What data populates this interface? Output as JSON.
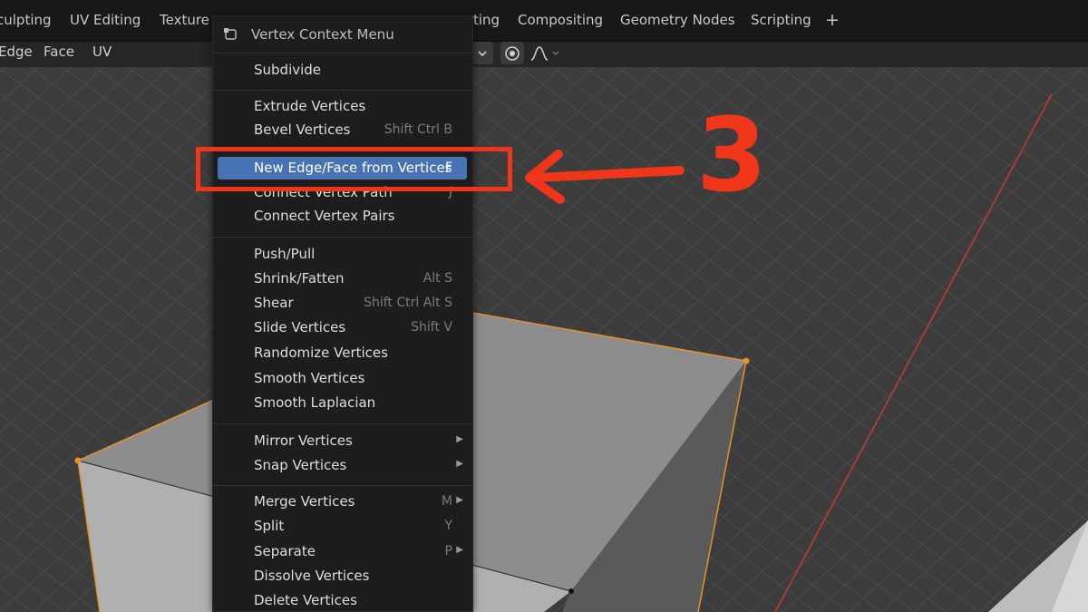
{
  "topbar": {
    "tabs": [
      "culpting",
      "UV Editing",
      "Texture",
      "ting",
      "Compositing",
      "Geometry Nodes",
      "Scripting"
    ],
    "add_tab": "+"
  },
  "header": {
    "mode_items": [
      "Edge",
      "Face",
      "UV"
    ]
  },
  "menu": {
    "title": "Vertex Context Menu",
    "items": [
      {
        "label": "Subdivide",
        "shortcut": ""
      },
      {
        "label": "Extrude Vertices",
        "shortcut": ""
      },
      {
        "label": "Bevel Vertices",
        "shortcut": "Shift Ctrl B"
      },
      {
        "label": "New Edge/Face from Vertices",
        "shortcut": "F"
      },
      {
        "label": "Connect Vertex Path",
        "shortcut": "J"
      },
      {
        "label": "Connect Vertex Pairs",
        "shortcut": ""
      },
      {
        "label": "Push/Pull",
        "shortcut": ""
      },
      {
        "label": "Shrink/Fatten",
        "shortcut": "Alt S"
      },
      {
        "label": "Shear",
        "shortcut": "Shift Ctrl Alt S"
      },
      {
        "label": "Slide Vertices",
        "shortcut": "Shift V"
      },
      {
        "label": "Randomize Vertices",
        "shortcut": ""
      },
      {
        "label": "Smooth Vertices",
        "shortcut": ""
      },
      {
        "label": "Smooth Laplacian",
        "shortcut": ""
      },
      {
        "label": "Mirror Vertices",
        "shortcut": ""
      },
      {
        "label": "Snap Vertices",
        "shortcut": ""
      },
      {
        "label": "Merge Vertices",
        "shortcut": "M"
      },
      {
        "label": "Split",
        "shortcut": "Y"
      },
      {
        "label": "Separate",
        "shortcut": "P"
      },
      {
        "label": "Dissolve Vertices",
        "shortcut": ""
      },
      {
        "label": "Delete Vertices",
        "shortcut": ""
      }
    ],
    "submenu_arrow": "▶",
    "highlight_color": "#4772b3"
  },
  "annotation": {
    "step": "3",
    "color": "#f0361a"
  },
  "colors": {
    "viewport_bg": "#3c3c3c",
    "grid_line": "#4b4b4b",
    "x_axis": "#a83a3a",
    "selection_orange": "#e8902a"
  }
}
